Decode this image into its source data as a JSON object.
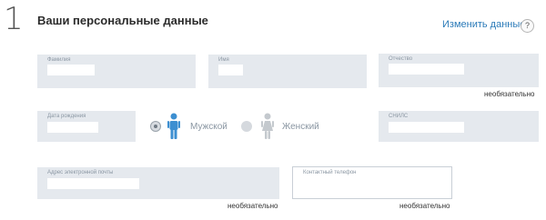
{
  "step": {
    "number": "1"
  },
  "header": {
    "title": "Ваши персональные данные",
    "change_link": "Изменить данные",
    "help": "?"
  },
  "fields": {
    "surname": {
      "label": "Фамилия",
      "value": ""
    },
    "name": {
      "label": "Имя",
      "value": ""
    },
    "patronymic": {
      "label": "Отчество",
      "value": "",
      "optional": "необязательно"
    },
    "birthdate": {
      "label": "Дата рождения",
      "value": ""
    },
    "snils": {
      "label": "СНИЛС",
      "value": ""
    },
    "email": {
      "label": "Адрес электронной почты",
      "value": "",
      "optional": "необязательно"
    },
    "phone": {
      "label": "Контактный телефон",
      "value": "",
      "optional": "необязательно"
    }
  },
  "gender": {
    "male": {
      "label": "Мужской",
      "selected": true,
      "icon": "male-person-icon",
      "color": "#3d8fd1"
    },
    "female": {
      "label": "Женский",
      "selected": false,
      "icon": "female-person-icon",
      "color": "#c4c9ce"
    }
  },
  "colors": {
    "link": "#2a7ab8",
    "field_bg": "#e5e9ee",
    "label": "#8b97a3"
  }
}
